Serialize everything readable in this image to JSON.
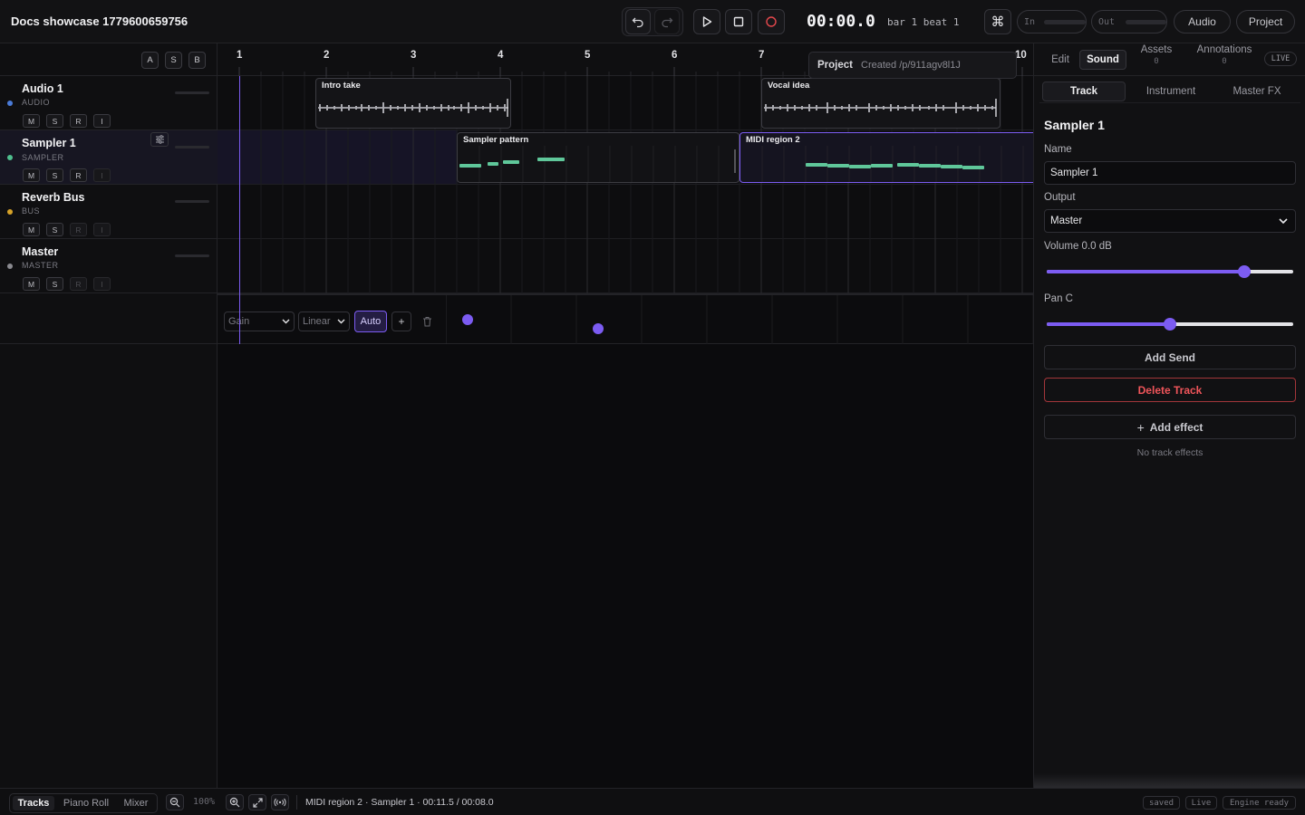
{
  "app": {
    "title": "Docs showcase 1779600659756"
  },
  "transport": {
    "time": "00:00.0",
    "position": "bar 1 beat 1",
    "in_label": "In",
    "out_label": "Out",
    "audio_label": "Audio",
    "project_label": "Project"
  },
  "header_buttons": [
    "A",
    "S",
    "B"
  ],
  "tracks": [
    {
      "name": "Audio 1",
      "type": "AUDIO",
      "color": "#4a7bd8",
      "buttons": [
        "M",
        "S",
        "R",
        "I"
      ]
    },
    {
      "name": "Sampler 1",
      "type": "SAMPLER",
      "color": "#4fbf8e",
      "buttons": [
        "M",
        "S",
        "R",
        "I"
      ]
    },
    {
      "name": "Reverb Bus",
      "type": "BUS",
      "color": "#d6a228",
      "buttons": [
        "M",
        "S",
        "R",
        "I"
      ]
    },
    {
      "name": "Master",
      "type": "MASTER",
      "color": "#8a8a90",
      "buttons": [
        "M",
        "S",
        "R",
        "I"
      ]
    }
  ],
  "ruler": [
    "1",
    "2",
    "3",
    "4",
    "5",
    "6",
    "7",
    "10"
  ],
  "regions": {
    "intro": "Intro take",
    "vocal": "Vocal idea",
    "sampler": "Sampler pattern",
    "midi2": "MIDI region 2"
  },
  "project_popup": {
    "title": "Project",
    "text": "Created /p/911agv8l1J"
  },
  "automation": {
    "param": "Gain",
    "curve": "Linear",
    "auto_label": "Auto",
    "add_label": "+"
  },
  "panel": {
    "tabs": [
      {
        "label": "Edit"
      },
      {
        "label": "Sound"
      },
      {
        "label": "Assets",
        "count": "0"
      },
      {
        "label": "Annotations",
        "count": "0"
      }
    ],
    "live_badge": "LIVE",
    "subtabs": [
      "Track",
      "Instrument",
      "Master FX"
    ],
    "title": "Sampler 1",
    "name_label": "Name",
    "name_value": "Sampler 1",
    "output_label": "Output",
    "output_value": "Master",
    "volume_label": "Volume 0.0 dB",
    "volume_level": 0.8,
    "pan_label": "Pan C",
    "pan_level": 0.5,
    "add_send": "Add Send",
    "delete_track": "Delete Track",
    "add_effect": "Add effect",
    "no_effects": "No track effects"
  },
  "status": {
    "tabs": [
      "Tracks",
      "Piano Roll",
      "Mixer"
    ],
    "zoom": "100%",
    "info": "MIDI region 2 · Sampler 1 · 00:11.5 / 00:08.0",
    "badges": [
      "saved",
      "Live",
      "Engine ready"
    ]
  },
  "colors": {
    "accent": "#7c5cf2",
    "note": "#5fc79a",
    "record": "#e5484d",
    "danger": "#e5484d"
  }
}
